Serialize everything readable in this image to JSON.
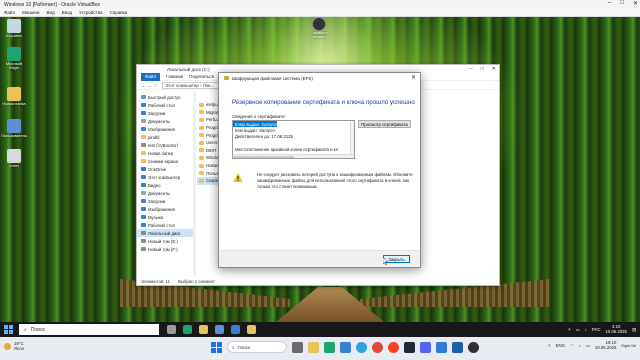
{
  "vbox": {
    "title": "Windows 10 [Работает] - Oracle VirtualBox",
    "menu": [
      "Файл",
      "Машина",
      "Вид",
      "Ввод",
      "Устройства",
      "Справка"
    ]
  },
  "desktop": {
    "icons": [
      {
        "label": "Корзина",
        "icon": "recycle-bin-icon",
        "color": "#c8d6e0"
      },
      {
        "label": "Microsoft Edge",
        "icon": "edge-icon",
        "color": "#1fa36f"
      },
      {
        "label": "Новая папка",
        "icon": "folder-icon",
        "color": "#e8c35a"
      },
      {
        "label": "Пользователь",
        "icon": "user-folder-icon",
        "color": "#5b8fd6"
      },
      {
        "label": "ключ",
        "icon": "key-file-icon",
        "color": "#d9d9d9"
      }
    ],
    "user_widget": "Сохранить\nсессию"
  },
  "explorer": {
    "title": "Локальный диск (C:)",
    "tabs": [
      "Файл",
      "Главная",
      "Поделиться",
      "Вид"
    ],
    "address": "Этот компьютер › Лок...",
    "nav": [
      {
        "label": "Быстрый доступ",
        "color": "#5b9bd5"
      },
      {
        "label": "Рабочий стол",
        "color": "#3a7fd0"
      },
      {
        "label": "Загрузки",
        "color": "#3a7fd0"
      },
      {
        "label": "Документы",
        "color": "#a0a0a0"
      },
      {
        "label": "Изображения",
        "color": "#3a7fd0"
      },
      {
        "label": "pindbl",
        "color": "#e8c35a"
      },
      {
        "label": "test (\\\\VBoxSvr)",
        "color": "#888"
      },
      {
        "label": "Новая папка",
        "color": "#e8c35a"
      },
      {
        "label": "Снимки экрана",
        "color": "#e8c35a"
      },
      {
        "label": "OneDrive",
        "color": "#2b7cd3"
      },
      {
        "label": "Этот компьютер",
        "color": "#3a7fd0"
      },
      {
        "label": "Видео",
        "color": "#3a7fd0"
      },
      {
        "label": "Документы",
        "color": "#a0a0a0"
      },
      {
        "label": "Загрузки",
        "color": "#3a7fd0"
      },
      {
        "label": "Изображения",
        "color": "#3a7fd0"
      },
      {
        "label": "Музыка",
        "color": "#3a7fd0"
      },
      {
        "label": "Рабочий стол",
        "color": "#3a7fd0"
      },
      {
        "label": "Локальный диск",
        "color": "#8a8a8a",
        "selected": true
      },
      {
        "label": "Новый том (E:)",
        "color": "#8a8a8a"
      },
      {
        "label": "Новый том (F:)",
        "color": "#8a8a8a"
      }
    ],
    "files": [
      {
        "label": "inetpub"
      },
      {
        "label": "MigrationExt"
      },
      {
        "label": "PerfLogs"
      },
      {
        "label": "Program Files"
      },
      {
        "label": "Program Files (x86)"
      },
      {
        "label": "Users"
      },
      {
        "label": "DIMT"
      },
      {
        "label": "Windows"
      },
      {
        "label": "Новая папка"
      },
      {
        "label": "Пользователи"
      },
      {
        "label": "Секреты",
        "selected": true
      }
    ],
    "status_count": "Элементов: 11",
    "status_selected": "Выбран 1 элемент"
  },
  "dialog": {
    "title": "Шифрующая файловая система (EFS)",
    "heading": "Резервное копирование сертификата и ключа прошло успешно",
    "info_label": "Сведения о сертификате:",
    "cert_lines": [
      "Кому выдан: Samyon",
      "Кем выдан: Samyon",
      "Действителен до: 17.06.2125",
      "",
      "Местоположение архивной копии сертификата и кл",
      "C:\\Users\\Samyon\\Desktop\\ключ.pfx"
    ],
    "view_cert_button": "Просмотр сертификата",
    "warning": "Не следует рисковать потерей доступа к зашифрованным файлам. Обновите зашифрованные файлы для использования этого сертификата и ключа, как только это станет возможным.",
    "close_button": "Закрыть"
  },
  "taskbar": {
    "search_placeholder": "Поиск",
    "icons": [
      {
        "icon": "task-view-icon",
        "color": "#9a9a9a"
      },
      {
        "icon": "edge-icon",
        "color": "#1fa36f"
      },
      {
        "icon": "explorer-icon",
        "color": "#e8c35a"
      },
      {
        "icon": "store-icon",
        "color": "#5b8fd6"
      },
      {
        "icon": "mail-icon",
        "color": "#3a7fd0"
      },
      {
        "icon": "explorer-active-icon",
        "color": "#e8c35a"
      }
    ],
    "lang": "РУС",
    "time": "4:10",
    "date": "10.06.2025"
  },
  "host": {
    "weather_temp": "19°C",
    "weather_desc": "Ясно",
    "search_placeholder": "Поиск",
    "lang": "ENG",
    "time": "19:10",
    "date": "10.06.2025",
    "vbox_hint": "Right Ctrl"
  }
}
